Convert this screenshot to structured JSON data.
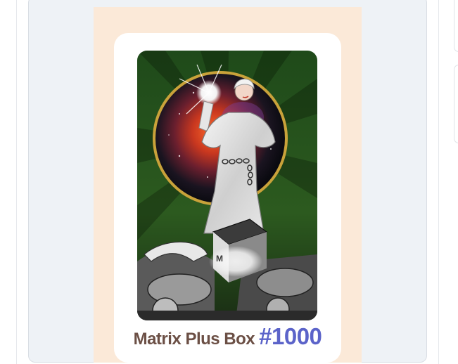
{
  "nft_card": {
    "name": "Matrix Plus Box",
    "number": "#1000",
    "artwork_icon": "woman-with-glowing-box-illustration",
    "colors": {
      "card_background": "#fbe9d8",
      "name_color": "#6b4f45",
      "number_color": "#5b63c9"
    }
  }
}
